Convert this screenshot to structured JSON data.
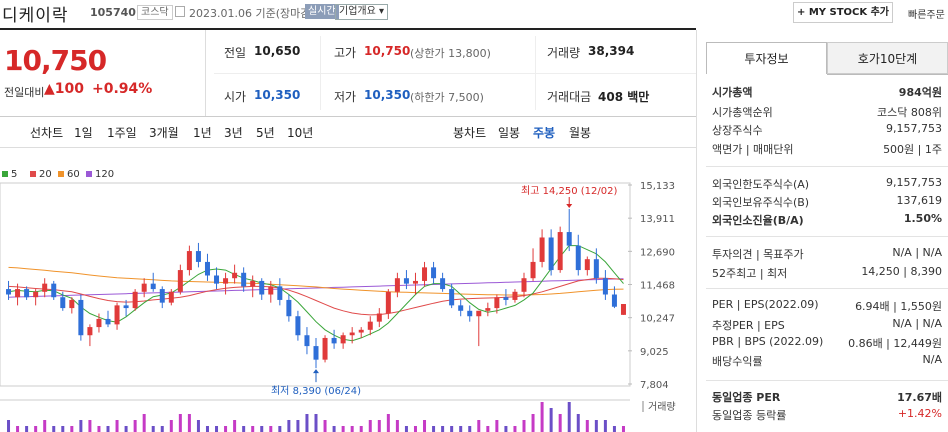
{
  "header": {
    "stock_name": "디케이락",
    "stock_code": "105740",
    "market": "코스닥",
    "date": "2023.01.06",
    "basis": "기준(장마감)",
    "realtime": "실시간",
    "company_overview": "기업개요",
    "mystock_button": "+ MY STOCK 추가",
    "quick_order": "빠른주문"
  },
  "price": {
    "current": "10,750",
    "change_label": "전일대비",
    "change_arrow": "▲",
    "change": "100",
    "change_pct": "+0.94%"
  },
  "summary": {
    "prev_close_label": "전일",
    "prev_close": "10,650",
    "high_label": "고가",
    "high": "10,750",
    "upper_limit": "(상한가 13,800)",
    "volume_label": "거래량",
    "volume": "38,394",
    "open_label": "시가",
    "open": "10,350",
    "low_label": "저가",
    "low": "10,350",
    "lower_limit": "(하한가 7,500)",
    "amount_label": "거래대금",
    "amount": "408 백만"
  },
  "chart_tabs": {
    "line_label": "선차트",
    "line_periods": [
      "1일",
      "1주일",
      "3개월",
      "1년",
      "3년",
      "5년",
      "10년"
    ],
    "candle_label": "봉차트",
    "candle_periods": [
      "일봉",
      "주봉",
      "월봉"
    ],
    "active": "주봉"
  },
  "chart_data": {
    "type": "candlestick",
    "legend": [
      {
        "name": "5",
        "color": "#3aa63a"
      },
      {
        "name": "20",
        "color": "#e04a4a"
      },
      {
        "name": "60",
        "color": "#f0932b"
      },
      {
        "name": "120",
        "color": "#9b59d6"
      }
    ],
    "y_ticks": [
      "15,133",
      "13,911",
      "12,690",
      "11,468",
      "10,247",
      "9,025",
      "7,804"
    ],
    "ylim": [
      7804,
      15133
    ],
    "high_annotation": "최고 14,250 (12/02)",
    "low_annotation": "최저 8,390 (06/24)",
    "volume_label": "거래량",
    "candles": [
      [
        11300,
        11600,
        10900,
        11100
      ],
      [
        11000,
        11500,
        10700,
        11300
      ],
      [
        11300,
        11400,
        10900,
        11000
      ],
      [
        11000,
        11300,
        10700,
        11200
      ],
      [
        11200,
        11700,
        11000,
        11500
      ],
      [
        11500,
        11600,
        10900,
        11000
      ],
      [
        11000,
        11200,
        10500,
        10600
      ],
      [
        10600,
        11000,
        10400,
        10900
      ],
      [
        10900,
        11100,
        9400,
        9600
      ],
      [
        9600,
        10000,
        9200,
        9900
      ],
      [
        9900,
        10400,
        9700,
        10200
      ],
      [
        10200,
        10500,
        9900,
        10000
      ],
      [
        10000,
        10800,
        9800,
        10700
      ],
      [
        10700,
        10900,
        10300,
        10600
      ],
      [
        10600,
        11300,
        10500,
        11200
      ],
      [
        11200,
        11700,
        11000,
        11500
      ],
      [
        11500,
        11900,
        11200,
        11300
      ],
      [
        11300,
        11400,
        10600,
        10800
      ],
      [
        10800,
        11300,
        10700,
        11200
      ],
      [
        11200,
        12200,
        11100,
        12000
      ],
      [
        12000,
        12900,
        11800,
        12700
      ],
      [
        12700,
        13000,
        12100,
        12300
      ],
      [
        12300,
        12600,
        11600,
        11800
      ],
      [
        11800,
        12100,
        11300,
        11500
      ],
      [
        11500,
        11900,
        11100,
        11700
      ],
      [
        11700,
        12200,
        11500,
        11900
      ],
      [
        11900,
        12100,
        11200,
        11400
      ],
      [
        11400,
        11800,
        11000,
        11600
      ],
      [
        11600,
        11700,
        10900,
        11100
      ],
      [
        11100,
        11600,
        10800,
        11400
      ],
      [
        11400,
        11700,
        10700,
        10900
      ],
      [
        10900,
        11100,
        10100,
        10300
      ],
      [
        10300,
        10500,
        9400,
        9600
      ],
      [
        9600,
        9900,
        8900,
        9200
      ],
      [
        9200,
        9500,
        8390,
        8700
      ],
      [
        8700,
        9600,
        8600,
        9500
      ],
      [
        9500,
        9800,
        9100,
        9300
      ],
      [
        9300,
        9700,
        9100,
        9600
      ],
      [
        9600,
        9900,
        9300,
        9700
      ],
      [
        9700,
        9900,
        9500,
        9800
      ],
      [
        9800,
        10300,
        9600,
        10100
      ],
      [
        10100,
        10600,
        9900,
        10400
      ],
      [
        10400,
        11300,
        10200,
        11200
      ],
      [
        11200,
        11900,
        11000,
        11700
      ],
      [
        11700,
        12000,
        11300,
        11500
      ],
      [
        11500,
        11900,
        11100,
        11600
      ],
      [
        11600,
        12300,
        11400,
        12100
      ],
      [
        12100,
        12300,
        11500,
        11700
      ],
      [
        11700,
        11900,
        11200,
        11300
      ],
      [
        11300,
        11500,
        10600,
        10700
      ],
      [
        10700,
        10900,
        10300,
        10500
      ],
      [
        10500,
        10700,
        10100,
        10300
      ],
      [
        10300,
        10500,
        9200,
        10500
      ],
      [
        10500,
        10800,
        10300,
        10600
      ],
      [
        10600,
        11100,
        10400,
        11000
      ],
      [
        11000,
        11300,
        10700,
        10900
      ],
      [
        10900,
        11300,
        10800,
        11200
      ],
      [
        11200,
        11900,
        11000,
        11700
      ],
      [
        11700,
        12800,
        11600,
        12300
      ],
      [
        12300,
        13500,
        12100,
        13200
      ],
      [
        13200,
        13500,
        11800,
        12000
      ],
      [
        12000,
        13600,
        11900,
        13400
      ],
      [
        13400,
        14250,
        12700,
        12900
      ],
      [
        12900,
        13300,
        11800,
        12000
      ],
      [
        12000,
        12500,
        11800,
        12400
      ],
      [
        12400,
        12800,
        11500,
        11700
      ],
      [
        11700,
        12000,
        10900,
        11100
      ],
      [
        11100,
        11400,
        10600,
        10650
      ],
      [
        10350,
        10750,
        10350,
        10750
      ]
    ],
    "ma5": [
      11200,
      11250,
      11220,
      11200,
      11260,
      11240,
      11080,
      10960,
      10640,
      10400,
      10260,
      10140,
      10080,
      10280,
      10540,
      10800,
      11020,
      11080,
      11160,
      11360,
      11600,
      11840,
      12000,
      12040,
      12000,
      11840,
      11700,
      11620,
      11520,
      11460,
      11340,
      11100,
      10820,
      10460,
      10100,
      9800,
      9600,
      9450,
      9400,
      9500,
      9650,
      9800,
      10050,
      10400,
      10750,
      11100,
      11400,
      11500,
      11500,
      11400,
      11100,
      10800,
      10550,
      10450,
      10500,
      10600,
      10700,
      10900,
      11150,
      11600,
      12050,
      12500,
      12900,
      12900,
      12750,
      12600,
      12300,
      11900,
      11500
    ],
    "ma20": [
      11400,
      11380,
      11350,
      11320,
      11300,
      11280,
      11240,
      11200,
      11120,
      11030,
      10950,
      10880,
      10840,
      10820,
      10830,
      10860,
      10900,
      10930,
      10960,
      11000,
      11060,
      11140,
      11220,
      11280,
      11330,
      11360,
      11380,
      11400,
      11400,
      11380,
      11340,
      11260,
      11150,
      11020,
      10880,
      10740,
      10600,
      10500,
      10420,
      10370,
      10350,
      10360,
      10400,
      10460,
      10540,
      10620,
      10700,
      10780,
      10850,
      10900,
      10930,
      10950,
      10960,
      10970,
      10980,
      11000,
      11020,
      11060,
      11120,
      11200,
      11300,
      11400,
      11500,
      11600,
      11650,
      11700,
      11700,
      11680,
      11650
    ],
    "ma60": [
      12100,
      12080,
      12050,
      12020,
      11990,
      11960,
      11930,
      11900,
      11860,
      11820,
      11780,
      11750,
      11720,
      11700,
      11680,
      11660,
      11640,
      11620,
      11600,
      11590,
      11580,
      11570,
      11560,
      11550,
      11540,
      11530,
      11520,
      11510,
      11500,
      11480,
      11460,
      11440,
      11420,
      11400,
      11380,
      11350,
      11320,
      11300,
      11280,
      11260,
      11240,
      11220,
      11200,
      11190,
      11180,
      11170,
      11160,
      11150,
      11140,
      11130,
      11120,
      11110,
      11100,
      11090,
      11090,
      11080,
      11080,
      11080,
      11090,
      11100,
      11120,
      11140,
      11170,
      11200,
      11230,
      11260,
      11280,
      11290,
      11300
    ],
    "ma120": [
      11000,
      11010,
      11020,
      11030,
      11040,
      11050,
      11060,
      11070,
      11080,
      11090,
      11100,
      11110,
      11120,
      11130,
      11140,
      11150,
      11160,
      11170,
      11180,
      11190,
      11200,
      11210,
      11220,
      11230,
      11240,
      11250,
      11260,
      11270,
      11280,
      11290,
      11300,
      11310,
      11320,
      11330,
      11340,
      11350,
      11360,
      11370,
      11380,
      11390,
      11400,
      11410,
      11420,
      11430,
      11440,
      11450,
      11460,
      11470,
      11480,
      11490,
      11500,
      11510,
      11520,
      11530,
      11540,
      11550,
      11560,
      11570,
      11580,
      11590,
      11600,
      11610,
      11620,
      11630,
      11640,
      11650,
      11660,
      11670,
      11680
    ],
    "volume": [
      2,
      1,
      1,
      1,
      2,
      1,
      1,
      1,
      2,
      2,
      1,
      1,
      2,
      1,
      2,
      3,
      1,
      1,
      2,
      3,
      3,
      2,
      1,
      1,
      1,
      2,
      1,
      1,
      1,
      1,
      1,
      2,
      2,
      3,
      3,
      2,
      1,
      1,
      1,
      1,
      2,
      2,
      3,
      2,
      1,
      1,
      2,
      1,
      1,
      1,
      1,
      1,
      2,
      1,
      2,
      1,
      1,
      2,
      3,
      5,
      4,
      3,
      5,
      3,
      2,
      2,
      2,
      1,
      1
    ]
  },
  "invest_info": {
    "tab_active": "투자정보",
    "tab_other": "호가10단계",
    "rows": [
      {
        "label": "시가총액",
        "value": "984억원",
        "bold": true
      },
      {
        "label": "시가총액순위",
        "value": "코스닥 808위"
      },
      {
        "label": "상장주식수",
        "value": "9,157,753"
      },
      {
        "label": "액면가 | 매매단위",
        "value": "500원 | 1주"
      },
      {
        "label": "외국인한도주식수(A)",
        "value": "9,157,753"
      },
      {
        "label": "외국인보유주식수(B)",
        "value": "137,619"
      },
      {
        "label": "외국인소진율(B/A)",
        "value": "1.50%",
        "bold": true
      },
      {
        "label": "투자의견 | 목표주가",
        "value": "N/A | N/A"
      },
      {
        "label": "52주최고 | 최저",
        "value": "14,250 | 8,390"
      },
      {
        "label": "PER | EPS(2022.09)",
        "value": "6.94배 | 1,550원"
      },
      {
        "label": "추정PER | EPS",
        "value": "N/A | N/A"
      },
      {
        "label": "PBR | BPS (2022.09)",
        "value": "0.86배 | 12,449원"
      },
      {
        "label": "배당수익률",
        "value": "N/A"
      },
      {
        "label": "동일업종 PER",
        "value": "17.67배",
        "bold": true
      },
      {
        "label": "동일업종 등락률",
        "value": "+1.42%",
        "red": true
      }
    ]
  }
}
